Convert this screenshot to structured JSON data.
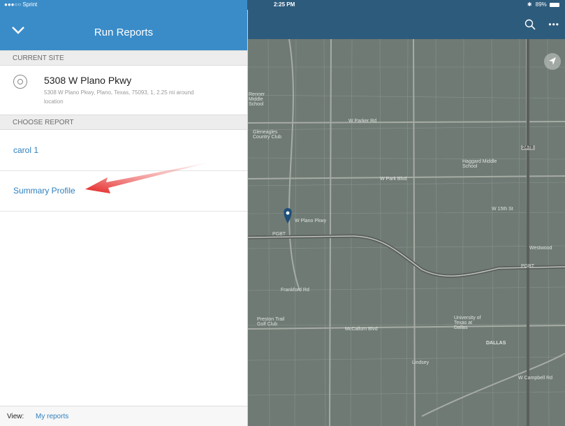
{
  "status_bar": {
    "carrier": "●●●○○ Sprint",
    "time": "2:25 PM",
    "battery": "89%"
  },
  "panel": {
    "title": "Run Reports",
    "current_site_header": "CURRENT SITE",
    "site_name": "5308 W Plano Pkwy",
    "site_detail": "5308 W Plano Pkwy, Plano, Texas, 75093, 1, 2.25 mi around location",
    "choose_report_header": "CHOOSE REPORT",
    "reports": [
      {
        "label": "carol 1"
      },
      {
        "label": "Summary Profile"
      }
    ],
    "footer": {
      "view_label": "View:",
      "view_link": "My reports"
    }
  },
  "map": {
    "labels": {
      "w_parker_rd": "W Parker Rd",
      "w_park_blvd": "W Park Blvd",
      "pgbt": "PGBT",
      "pgbt_east": "PGBT",
      "frankford_rd": "Frankford Rd",
      "mccallum_blvd": "McCallum Blvd",
      "dallas": "DALLAS",
      "w_plano_pkwy": "W Plano Pkwy",
      "haggard_middle_school": "Haggard Middle School",
      "w_15th_st": "W 15th St",
      "campbell_rd": "W Campbell Rd",
      "lindsey": "Lindsey",
      "glen_eagles": "Gleneagles Country Club",
      "university": "University of Texas at Dallas",
      "renner": "Renner Middle School",
      "preston_trail": "Preston Trail Golf Club",
      "road_2478": "2478",
      "westwood": "Westwood"
    }
  },
  "colors": {
    "panel_header": "#3a8cc8",
    "map_toolbar": "#2d5b7c",
    "link": "#2e7fbd",
    "arrow": "#e41f1f",
    "pin": "#1f4f7a"
  }
}
